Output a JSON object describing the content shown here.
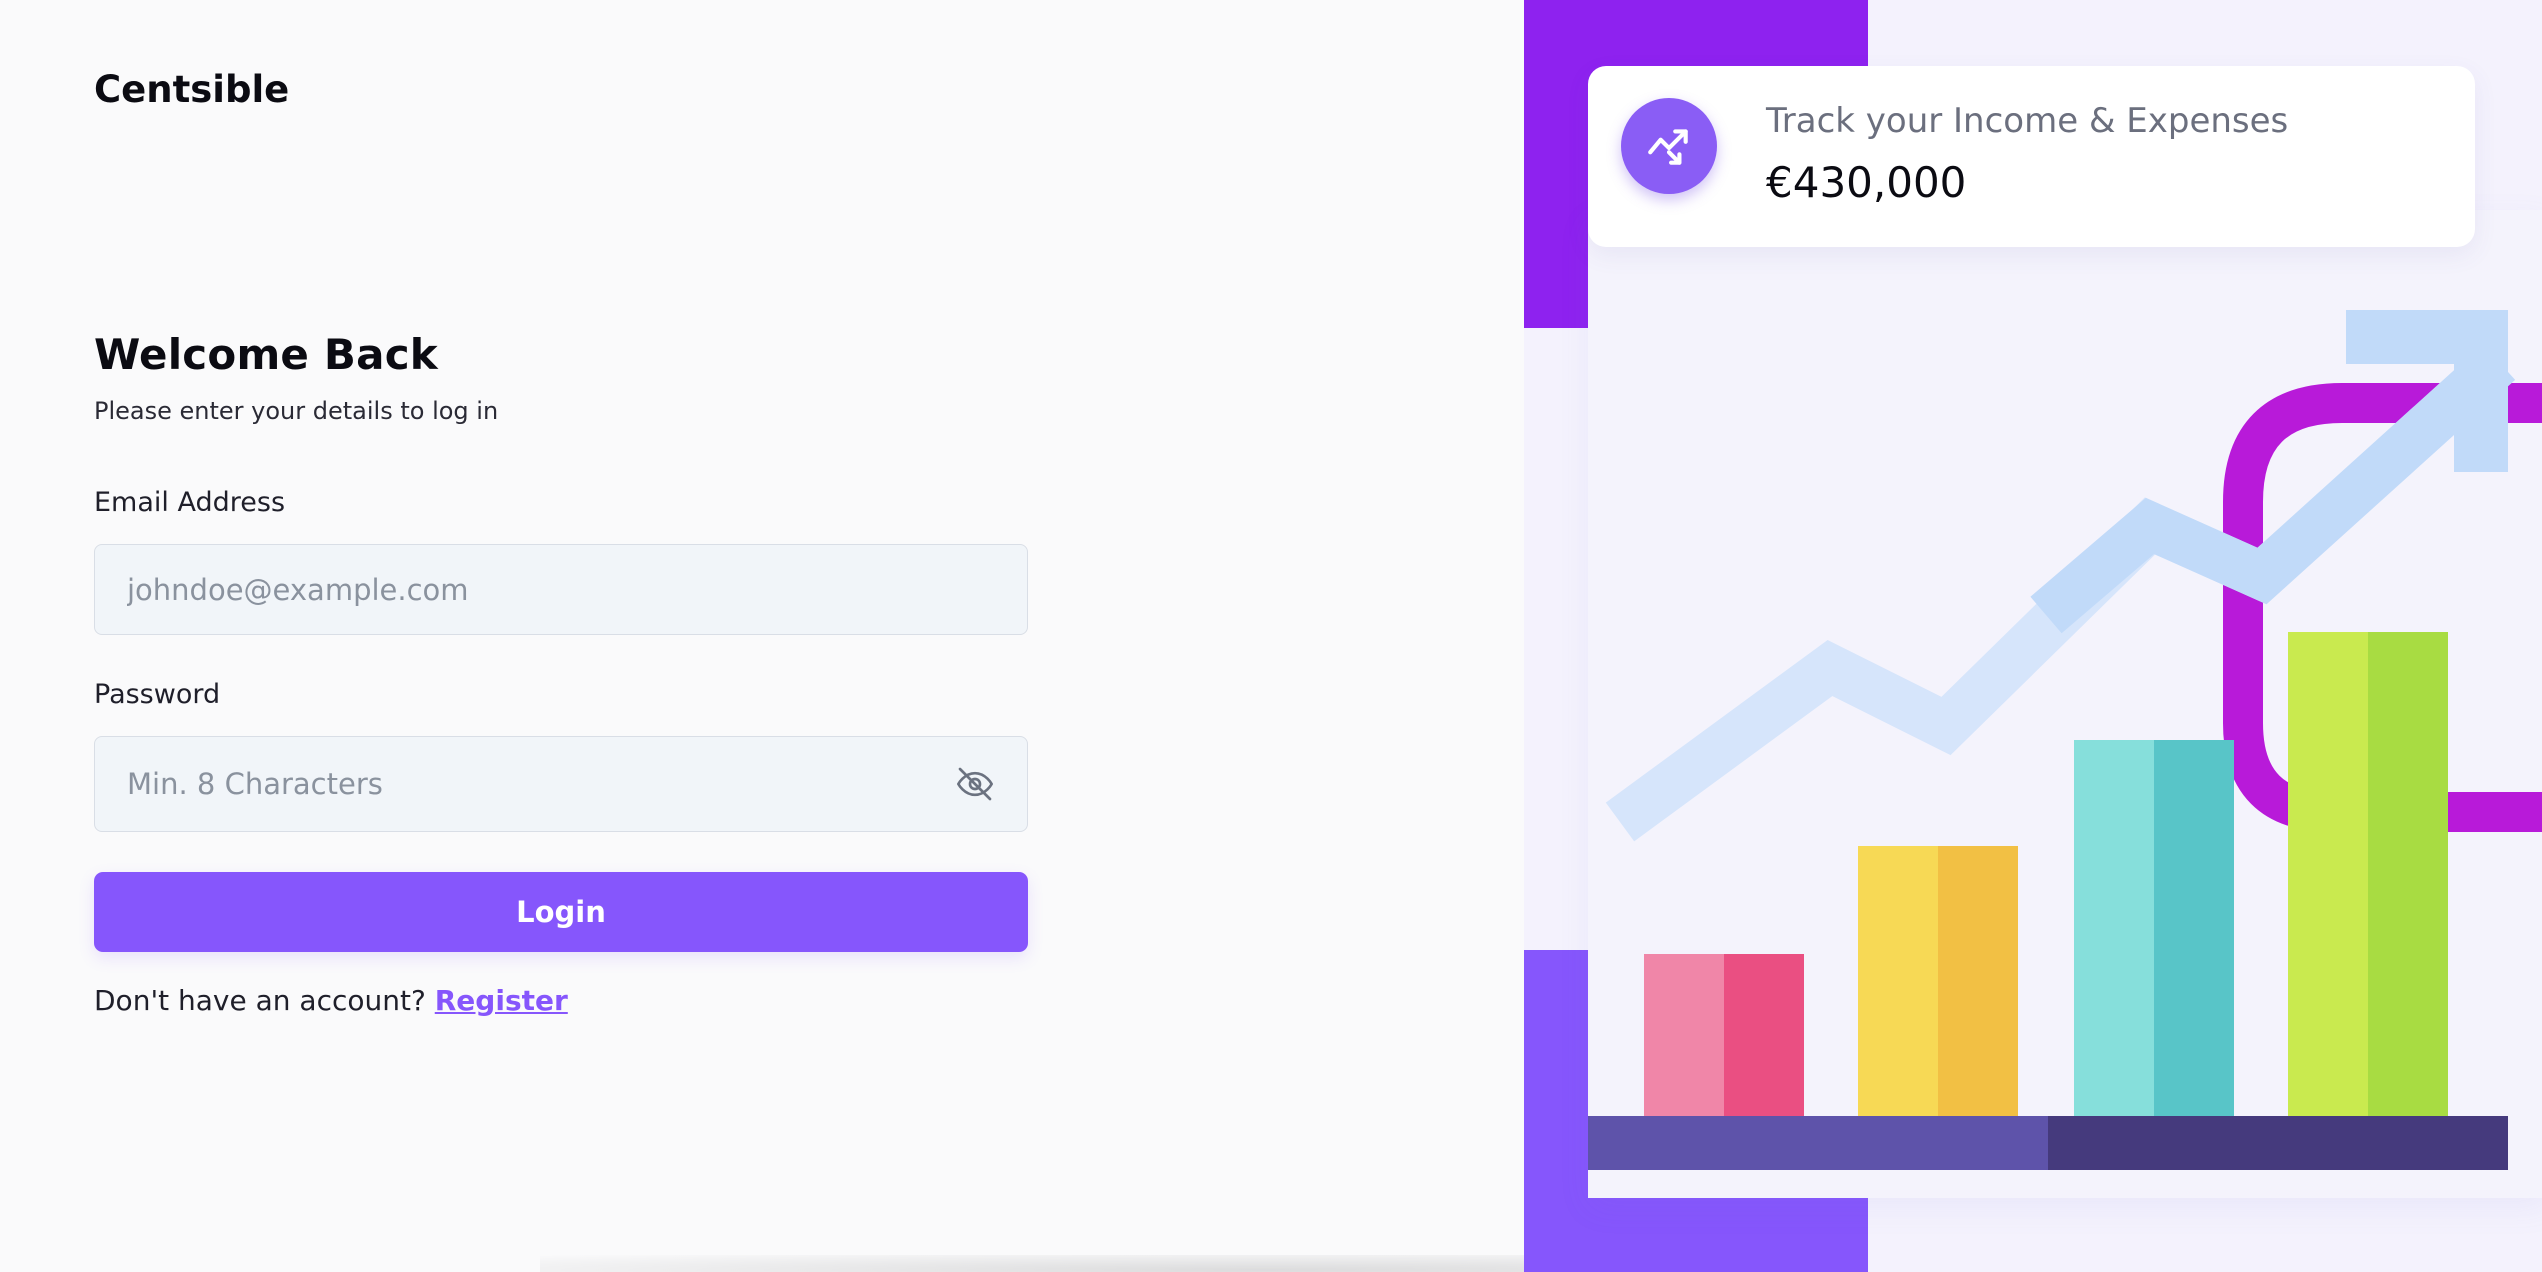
{
  "app": {
    "brand": "Centsible"
  },
  "login": {
    "title": "Welcome Back",
    "subtitle": "Please enter your details to log in",
    "email_label": "Email Address",
    "email_placeholder": "johndoe@example.com",
    "email_value": "",
    "password_label": "Password",
    "password_placeholder": "Min. 8 Characters",
    "password_value": "",
    "password_toggle_icon": "eye-off-icon",
    "login_button": "Login",
    "register_prompt": "Don't have an account?",
    "register_link": "Register"
  },
  "promo": {
    "stat_icon": "trending-up-icon",
    "stat_label": "Track your Income & Expenses",
    "stat_value": "€430,000"
  },
  "colors": {
    "accent": "#8656fc",
    "accent_dark": "#8e22ef",
    "input_bg": "#f1f5f9"
  }
}
